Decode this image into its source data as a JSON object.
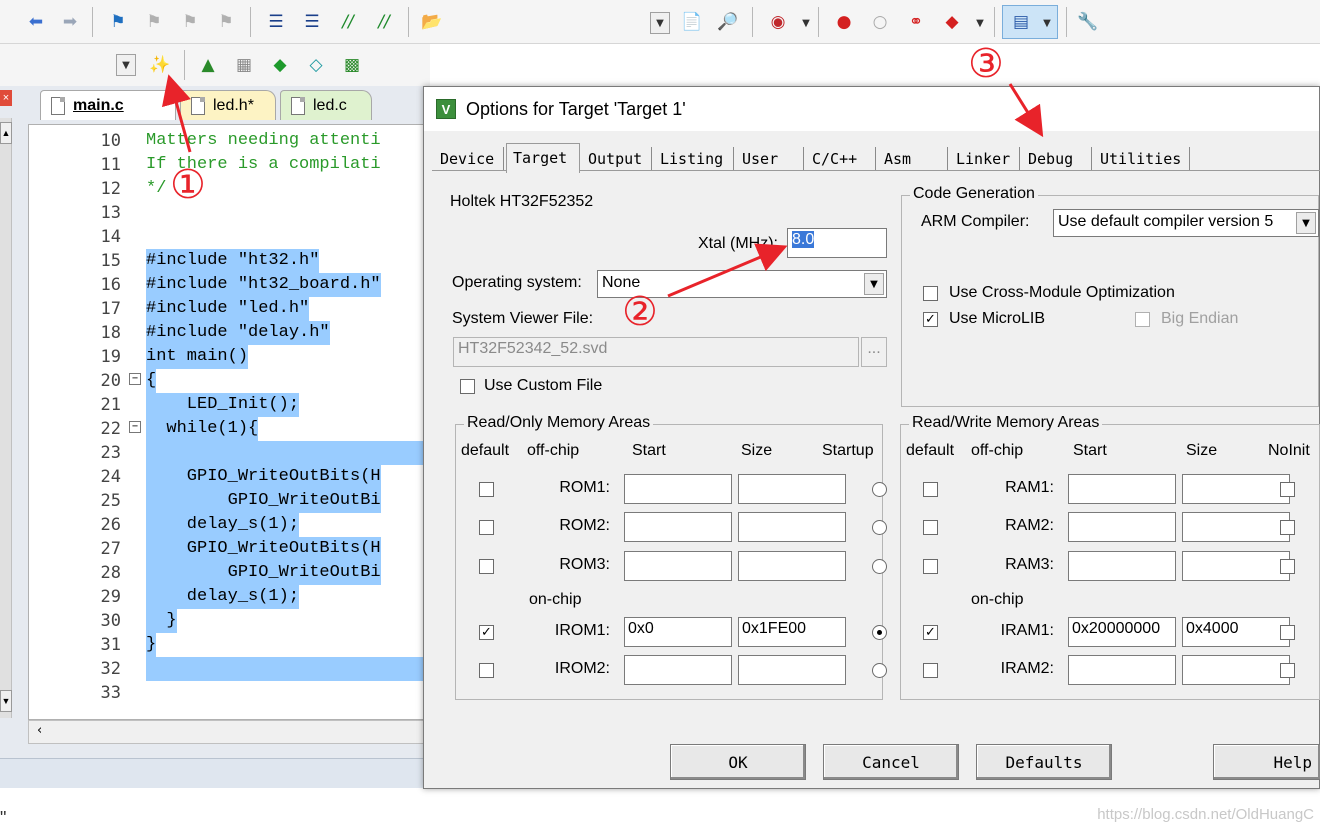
{
  "editor": {
    "tabs": [
      {
        "label": "main.c",
        "active": true
      },
      {
        "label": "led.h*",
        "active": false
      },
      {
        "label": "led.c",
        "active": false
      }
    ],
    "lines": [
      {
        "no": "10",
        "text": "Matters needing attenti",
        "kind": "comment"
      },
      {
        "no": "11",
        "text": "If there is a compilati",
        "kind": "comment"
      },
      {
        "no": "12",
        "text": "*/",
        "kind": "comment"
      },
      {
        "no": "13",
        "text": "",
        "kind": "plain"
      },
      {
        "no": "14",
        "text": "",
        "kind": "plain"
      },
      {
        "no": "15",
        "text": "#include \"ht32.h\"",
        "kind": "selected"
      },
      {
        "no": "16",
        "text": "#include \"ht32_board.h\"",
        "kind": "selected"
      },
      {
        "no": "17",
        "text": "#include \"led.h\"",
        "kind": "selected"
      },
      {
        "no": "18",
        "text": "#include \"delay.h\"",
        "kind": "selected"
      },
      {
        "no": "19",
        "text": "int main()",
        "kind": "selected"
      },
      {
        "no": "20",
        "text": "{",
        "kind": "selected"
      },
      {
        "no": "21",
        "text": "    LED_Init();",
        "kind": "selected"
      },
      {
        "no": "22",
        "text": "  while(1){",
        "kind": "selected"
      },
      {
        "no": "23",
        "text": "",
        "kind": "selected"
      },
      {
        "no": "24",
        "text": "    GPIO_WriteOutBits(H",
        "kind": "selected"
      },
      {
        "no": "25",
        "text": "        GPIO_WriteOutBi",
        "kind": "selected"
      },
      {
        "no": "26",
        "text": "    delay_s(1);",
        "kind": "selected"
      },
      {
        "no": "27",
        "text": "    GPIO_WriteOutBits(H",
        "kind": "selected"
      },
      {
        "no": "28",
        "text": "        GPIO_WriteOutBi",
        "kind": "selected"
      },
      {
        "no": "29",
        "text": "    delay_s(1);",
        "kind": "selected"
      },
      {
        "no": "30",
        "text": "  }",
        "kind": "selected"
      },
      {
        "no": "31",
        "text": "}",
        "kind": "selected"
      },
      {
        "no": "32",
        "text": "",
        "kind": "selected"
      },
      {
        "no": "33",
        "text": "",
        "kind": "plain"
      }
    ]
  },
  "dialog": {
    "title": "Options for Target 'Target 1'",
    "tabs": [
      "Device",
      "Target",
      "Output",
      "Listing",
      "User",
      "C/C++",
      "Asm",
      "Linker",
      "Debug",
      "Utilities"
    ],
    "active_tab": "Target",
    "device_name": "Holtek HT32F52352",
    "xtal_label": "Xtal (MHz):",
    "xtal_value": "8.0",
    "os_label": "Operating system:",
    "os_value": "None",
    "svf_label": "System Viewer File:",
    "svf_value": "HT32F52342_52.svd",
    "svf_browse": "...",
    "use_custom_file": "Use Custom File",
    "code_gen": {
      "title": "Code Generation",
      "compiler_label": "ARM Compiler:",
      "compiler_value": "Use default compiler version 5",
      "cross_module": "Use Cross-Module Optimization",
      "cross_module_checked": false,
      "microlib": "Use MicroLIB",
      "microlib_checked": true,
      "big_endian": "Big Endian",
      "big_endian_checked": false
    },
    "rom": {
      "title": "Read/Only Memory Areas",
      "headers": [
        "default",
        "off-chip",
        "Start",
        "Size",
        "Startup"
      ],
      "on_chip": "on-chip",
      "rows": [
        {
          "name": "ROM1:",
          "start": "",
          "size": "",
          "default": false,
          "startup": false
        },
        {
          "name": "ROM2:",
          "start": "",
          "size": "",
          "default": false,
          "startup": false
        },
        {
          "name": "ROM3:",
          "start": "",
          "size": "",
          "default": false,
          "startup": false
        },
        {
          "name": "IROM1:",
          "start": "0x0",
          "size": "0x1FE00",
          "default": true,
          "startup": true
        },
        {
          "name": "IROM2:",
          "start": "",
          "size": "",
          "default": false,
          "startup": false
        }
      ]
    },
    "ram": {
      "title": "Read/Write Memory Areas",
      "headers": [
        "default",
        "off-chip",
        "Start",
        "Size",
        "NoInit"
      ],
      "on_chip": "on-chip",
      "rows": [
        {
          "name": "RAM1:",
          "start": "",
          "size": "",
          "default": false,
          "noinit": false
        },
        {
          "name": "RAM2:",
          "start": "",
          "size": "",
          "default": false,
          "noinit": false
        },
        {
          "name": "RAM3:",
          "start": "",
          "size": "",
          "default": false,
          "noinit": false
        },
        {
          "name": "IRAM1:",
          "start": "0x20000000",
          "size": "0x4000",
          "default": true,
          "noinit": false
        },
        {
          "name": "IRAM2:",
          "start": "",
          "size": "",
          "default": false,
          "noinit": false
        }
      ]
    },
    "buttons": {
      "ok": "OK",
      "cancel": "Cancel",
      "defaults": "Defaults",
      "help": "Help"
    }
  },
  "annotations": {
    "one": "①",
    "two": "②",
    "three": "③",
    "color": "#e8232a"
  },
  "watermark": "https://blog.csdn.net/OldHuangC",
  "footer_mark": "\""
}
